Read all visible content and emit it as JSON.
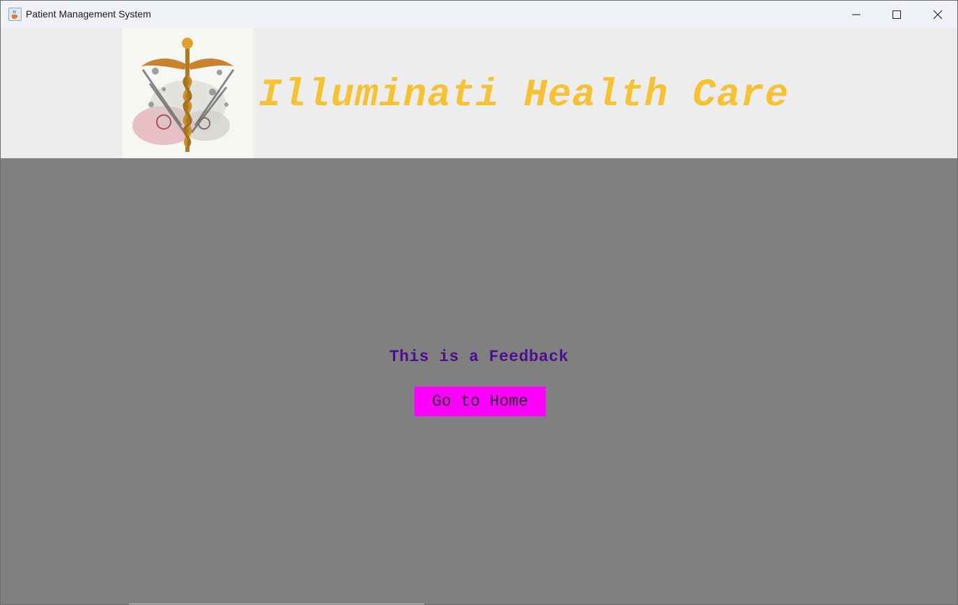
{
  "window": {
    "title": "Patient Management System",
    "icon": "java-cup-icon",
    "controls": [
      "minimize-icon",
      "maximize-icon",
      "close-icon"
    ]
  },
  "header": {
    "brand": "Illuminati Health Care",
    "logo": "caduceus-logo"
  },
  "main": {
    "message": "This is a Feedback",
    "home_button_label": "Go to Home"
  },
  "colors": {
    "brand": "#f6c232",
    "message": "#4b0f8f",
    "button": "#ff00ff",
    "content_bg": "#808080",
    "header_bg": "#ededed"
  }
}
